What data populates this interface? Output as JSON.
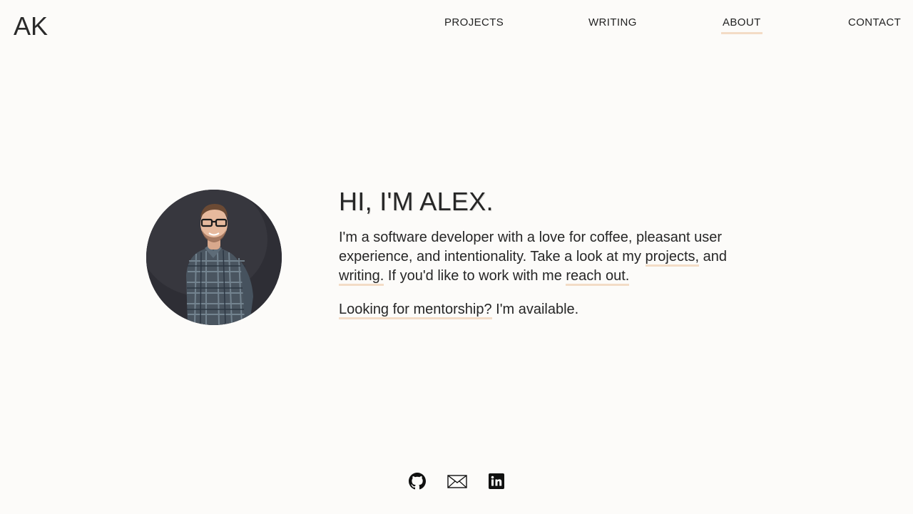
{
  "header": {
    "logo": "AK",
    "nav": [
      {
        "label": "PROJECTS",
        "active": false
      },
      {
        "label": "WRITING",
        "active": false
      },
      {
        "label": "ABOUT",
        "active": true
      },
      {
        "label": "CONTACT",
        "active": false
      }
    ]
  },
  "hero": {
    "title": "HI, I'M ALEX.",
    "intro": {
      "text1": "I'm a software developer with a love for coffee, pleasant user experience, and intentionality. Take a look at my ",
      "link_projects": "projects,",
      "text2": " and ",
      "link_writing": "writing.",
      "text3": " If you'd like to work with me ",
      "link_contact": "reach out.",
      "text4": ""
    },
    "mentor": {
      "link": "Looking for mentorship?",
      "text": " I'm available."
    }
  },
  "footer": {
    "icons": [
      "github-icon",
      "mail-icon",
      "linkedin-icon"
    ]
  },
  "colors": {
    "background": "#fcfbf9",
    "text": "#222222",
    "accent_underline": "#f3dcc6"
  }
}
